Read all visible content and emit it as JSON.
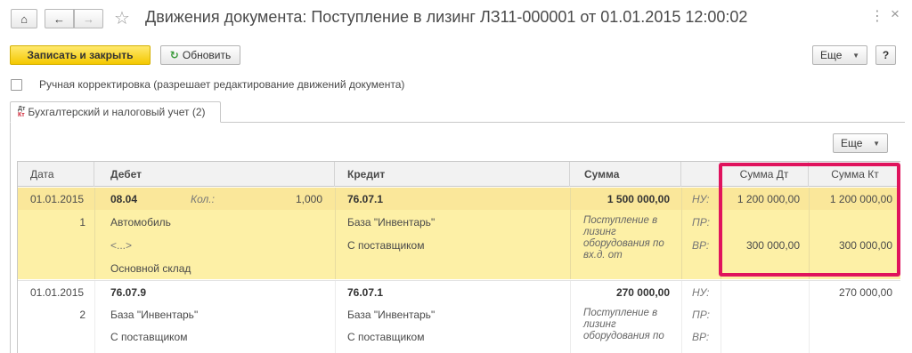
{
  "window": {
    "title": "Движения документа: Поступление в лизинг ЛЗ11-000001 от 01.01.2015 12:00:02",
    "menu_icon": "⋮",
    "close_icon": "×"
  },
  "nav": {
    "home_icon": "⌂",
    "back_icon": "←",
    "forward_icon": "→",
    "favorite_icon": "☆"
  },
  "toolbar": {
    "save_close_label": "Записать и закрыть",
    "refresh_label": "Обновить",
    "refresh_icon": "↻",
    "more_label": "Еще",
    "help_label": "?"
  },
  "manual_correction": {
    "label": "Ручная корректировка (разрешает редактирование движений документа)",
    "checked": false
  },
  "tab": {
    "label": "Бухгалтерский и налоговый учет (2)"
  },
  "grid": {
    "more_label": "Еще",
    "columns": {
      "date": "Дата",
      "debit": "Дебет",
      "credit": "Кредит",
      "amount": "Сумма",
      "amount_dt": "Сумма Дт",
      "amount_kt": "Сумма Кт"
    },
    "rows": [
      {
        "date": "01.01.2015",
        "number": "1",
        "debit_account": "08.04",
        "qty_label": "Кол.:",
        "qty_value": "1,000",
        "debit_sub1": "Автомобиль",
        "debit_sub2": "<...>",
        "debit_sub3": "Основной склад",
        "credit_account": "76.07.1",
        "credit_sub1": "База \"Инвентарь\"",
        "credit_sub2": "С поставщиком",
        "amount": "1 500 000,00",
        "content": "Поступление в лизинг оборудования по вх.д. от",
        "tax_nu": "НУ:",
        "tax_pr": "ПР:",
        "tax_vr": "ВР:",
        "nu_dt": "1 200 000,00",
        "nu_kt": "1 200 000,00",
        "vr_dt": "300 000,00",
        "vr_kt": "300 000,00"
      },
      {
        "date": "01.01.2015",
        "number": "2",
        "debit_account": "76.07.9",
        "debit_sub1": "База \"Инвентарь\"",
        "debit_sub2": "С поставщиком",
        "credit_account": "76.07.1",
        "credit_sub1": "База \"Инвентарь\"",
        "credit_sub2": "С поставщиком",
        "amount": "270 000,00",
        "content": "Поступление в лизинг оборудования по",
        "tax_nu": "НУ:",
        "tax_pr": "ПР:",
        "tax_vr": "ВР:",
        "nu_kt": "270 000,00"
      }
    ]
  },
  "colors": {
    "highlight": "#e0135d",
    "selected_row": "#fdf0a6",
    "primary_button": "#f4c800"
  }
}
